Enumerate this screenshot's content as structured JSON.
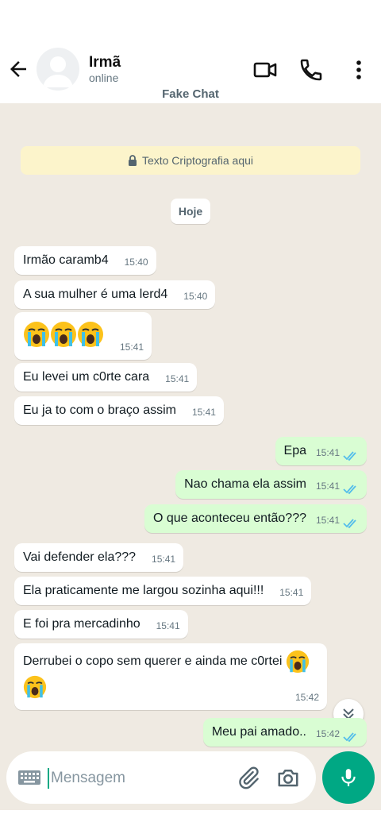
{
  "header": {
    "contact_name": "Irmã",
    "status": "online",
    "caption": "Fake Chat"
  },
  "chat": {
    "encryption_notice": "Texto Criptografia aqui",
    "date_label": "Hoje",
    "messages": [
      {
        "dir": "in",
        "text": "Irmão caramb4",
        "time": "15:40"
      },
      {
        "dir": "in",
        "text": "A sua mulher é uma lerd4",
        "time": "15:40"
      },
      {
        "dir": "in",
        "emoji": "loudly-crying-face x3",
        "time": "15:41"
      },
      {
        "dir": "in",
        "text": "Eu levei um c0rte cara",
        "time": "15:41"
      },
      {
        "dir": "in",
        "text": "Eu ja to com o braço assim",
        "time": "15:41"
      },
      {
        "dir": "out",
        "text": "Epa",
        "time": "15:41",
        "status": "read"
      },
      {
        "dir": "out",
        "text": "Nao chama ela assim",
        "time": "15:41",
        "status": "read"
      },
      {
        "dir": "out",
        "text": "O que aconteceu então???",
        "time": "15:41",
        "status": "read"
      },
      {
        "dir": "in",
        "text": "Vai defender ela???",
        "time": "15:41"
      },
      {
        "dir": "in",
        "text": "Ela praticamente me largou sozinha aqui!!!",
        "time": "15:41"
      },
      {
        "dir": "in",
        "text": "E foi pra mercadinho",
        "time": "15:41"
      },
      {
        "dir": "in",
        "text": "Derrubei o copo sem querer e ainda me c0rtei",
        "time": "15:42"
      },
      {
        "dir": "out",
        "text": "Meu pai amado..",
        "time": "15:42",
        "status": "read"
      }
    ]
  },
  "composer": {
    "placeholder": "Mensagem"
  },
  "colors": {
    "accent": "#00a884",
    "outgoing_bubble": "#d9fdd3",
    "chat_background": "#efeae2",
    "read_ticks": "#53bdeb"
  }
}
